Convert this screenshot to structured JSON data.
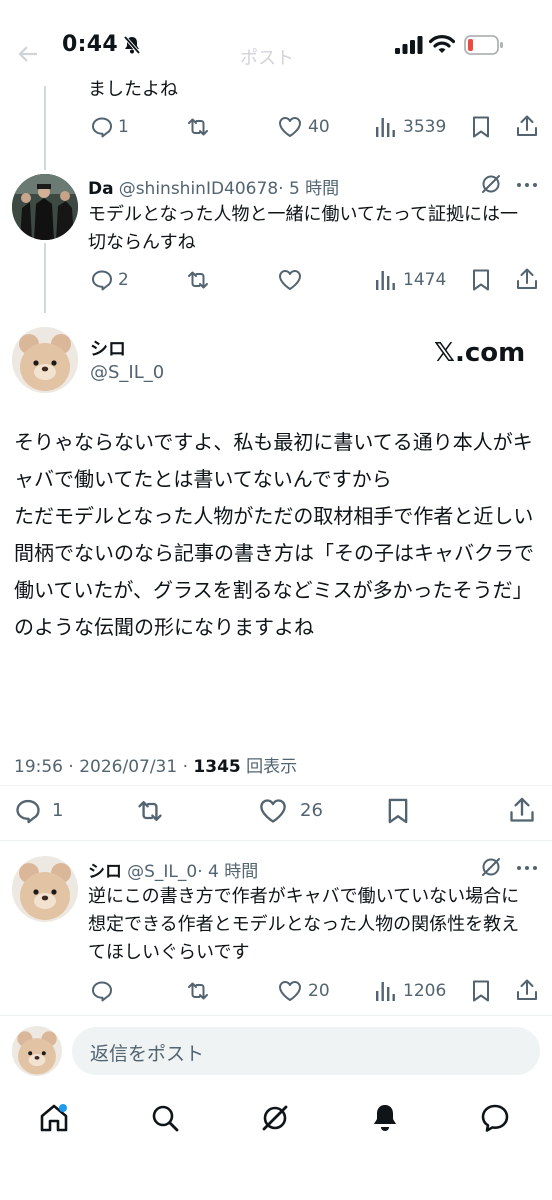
{
  "status_bar": {
    "time": "0:44",
    "faded_title": "ポスト"
  },
  "prev_tweet": {
    "text_tail": "ましたよね",
    "replies": "1",
    "likes": "40",
    "views": "3539"
  },
  "tweet_da": {
    "name": "Da",
    "handle": "@shinshinID40678",
    "time": "· 5 時間",
    "text": "モデルとなった人物と一緒に働いてたって証拠には一切ならんすね",
    "replies": "2",
    "views": "1474"
  },
  "main_tweet": {
    "name": "シロ",
    "handle": "@S_IL_0",
    "watermark": "𝕏.com",
    "text": "そりゃならないですよ、私も最初に書いてる通り本人がキャバで働いてたとは書いてないんですから\nただモデルとなった人物がただの取材相手で作者と近しい間柄でないのなら記事の書き方は「その子はキャバクラで働いていたが、グラスを割るなどミスが多かったそうだ」のような伝聞の形になりますよね",
    "timestamp": "19:56 · 2026/07/31 · ",
    "views_count": "1345",
    "views_label": " 回表示",
    "replies": "1",
    "likes": "26"
  },
  "tweet_shiro_reply": {
    "name": "シロ",
    "handle": "@S_IL_0",
    "time": "· 4 時間",
    "text": "逆にこの書き方で作者がキャバで働いていない場合に想定できる作者とモデルとなった人物の関係性を教えてほしいぐらいです",
    "likes": "20",
    "views": "1206"
  },
  "reply_bar": {
    "placeholder": "返信をポスト"
  },
  "colors": {
    "text": "#0f1419",
    "muted": "#536471",
    "accent": "#1d9bf0",
    "battery_low": "#eb4b3e"
  },
  "bottom_nav": [
    "home-icon",
    "search-icon",
    "grok-icon",
    "notifications-icon",
    "messages-icon"
  ]
}
